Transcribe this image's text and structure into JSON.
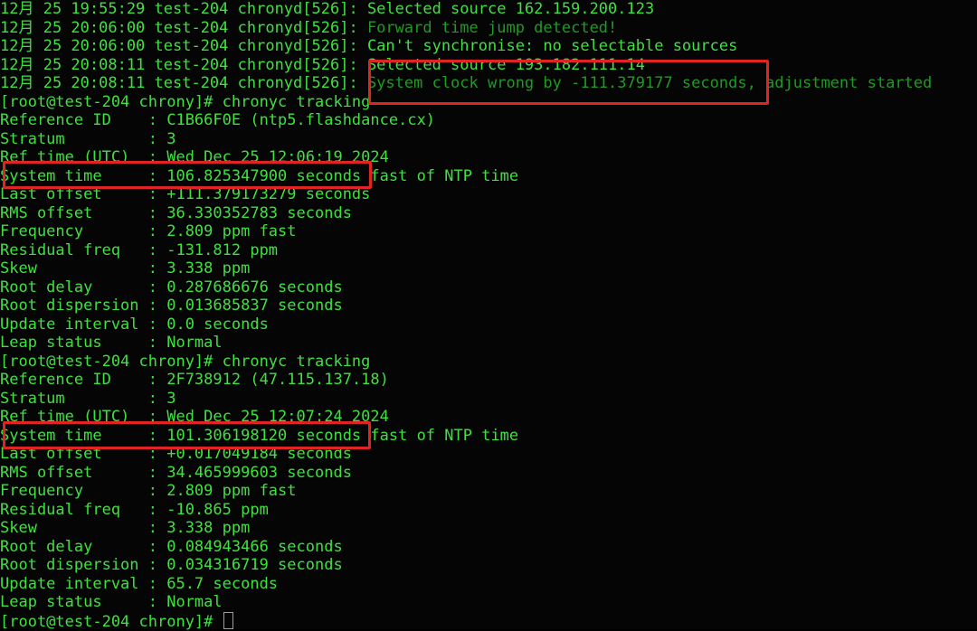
{
  "colors": {
    "text": "#3fe03f",
    "dim_text": "#1f9a22",
    "highlight_box": "#e02424",
    "background": "#050505"
  },
  "lines": [
    [
      {
        "t": "12月 25 19:55:29 test-204 chronyd[526]: "
      },
      {
        "t": "Selected source 162.159.200.123"
      }
    ],
    [
      {
        "t": "12月 25 20:06:00 test-204 chronyd[526]: "
      },
      {
        "t": "Forward time jump detected!",
        "dim": true
      }
    ],
    [
      {
        "t": "12月 25 20:06:00 test-204 chronyd[526]: "
      },
      {
        "t": "Can't synchronise: no selectable sources"
      }
    ],
    [
      {
        "t": "12月 25 20:08:11 test-204 chronyd[526]: "
      },
      {
        "t": "Selected source 193.182.111.14"
      }
    ],
    [
      {
        "t": "12月 25 20:08:11 test-204 chronyd[526]: "
      },
      {
        "t": "System clock wrong by -111.379177 seconds, adjustment started",
        "dim": true
      }
    ],
    [
      {
        "t": "[root@test-204 chrony]# chronyc tracking"
      }
    ],
    [
      {
        "t": "Reference ID    : C1B66F0E (ntp5.flashdance.cx)"
      }
    ],
    [
      {
        "t": "Stratum         : 3"
      }
    ],
    [
      {
        "t": "Ref time (UTC)  : Wed Dec 25 12:06:19 2024"
      }
    ],
    [
      {
        "t": "System time     : 106.825347900 seconds fast of NTP time"
      }
    ],
    [
      {
        "t": "Last offset     : +111.379173279 seconds"
      }
    ],
    [
      {
        "t": "RMS offset      : 36.330352783 seconds"
      }
    ],
    [
      {
        "t": "Frequency       : 2.809 ppm fast"
      }
    ],
    [
      {
        "t": "Residual freq   : -131.812 ppm"
      }
    ],
    [
      {
        "t": "Skew            : 3.338 ppm"
      }
    ],
    [
      {
        "t": "Root delay      : 0.287686676 seconds"
      }
    ],
    [
      {
        "t": "Root dispersion : 0.013685837 seconds"
      }
    ],
    [
      {
        "t": "Update interval : 0.0 seconds"
      }
    ],
    [
      {
        "t": "Leap status     : Normal"
      }
    ],
    [
      {
        "t": "[root@test-204 chrony]# chronyc tracking"
      }
    ],
    [
      {
        "t": "Reference ID    : 2F738912 (47.115.137.18)"
      }
    ],
    [
      {
        "t": "Stratum         : 3"
      }
    ],
    [
      {
        "t": "Ref time (UTC)  : Wed Dec 25 12:07:24 2024"
      }
    ],
    [
      {
        "t": "System time     : 101.306198120 seconds fast of NTP time"
      }
    ],
    [
      {
        "t": "Last offset     : +0.017049184 seconds"
      }
    ],
    [
      {
        "t": "RMS offset      : 34.465999603 seconds"
      }
    ],
    [
      {
        "t": "Frequency       : 2.809 ppm fast"
      }
    ],
    [
      {
        "t": "Residual freq   : -10.865 ppm"
      }
    ],
    [
      {
        "t": "Skew            : 3.338 ppm"
      }
    ],
    [
      {
        "t": "Root delay      : 0.084943466 seconds"
      }
    ],
    [
      {
        "t": "Root dispersion : 0.034316719 seconds"
      }
    ],
    [
      {
        "t": "Update interval : 65.7 seconds"
      }
    ],
    [
      {
        "t": "Leap status     : Normal"
      }
    ],
    [
      {
        "t": "[root@test-204 chrony]# "
      }
    ]
  ]
}
